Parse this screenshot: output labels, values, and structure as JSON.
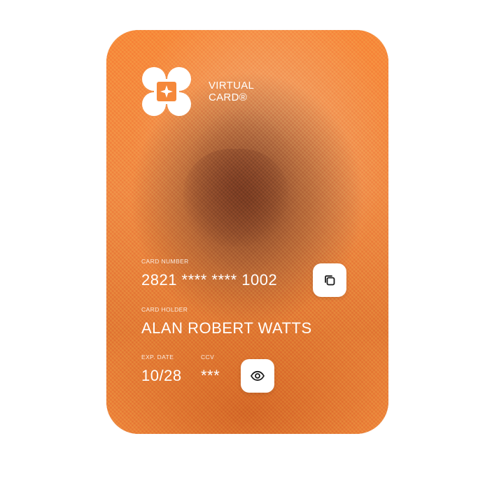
{
  "card": {
    "brand_line1": "VIRTUAL",
    "brand_line2": "CARD®",
    "number_label": "CARD NUMBER",
    "number": "2821 **** **** 1002",
    "holder_label": "CARD HOLDER",
    "holder": "ALAN ROBERT WATTS",
    "exp_label": "EXP. DATE",
    "exp": "10/28",
    "ccv_label": "CCV",
    "ccv": "***",
    "background_color": "#f5883a"
  },
  "icons": {
    "logo": "card-brand-logo",
    "copy": "copy-icon",
    "reveal": "eye-icon"
  }
}
